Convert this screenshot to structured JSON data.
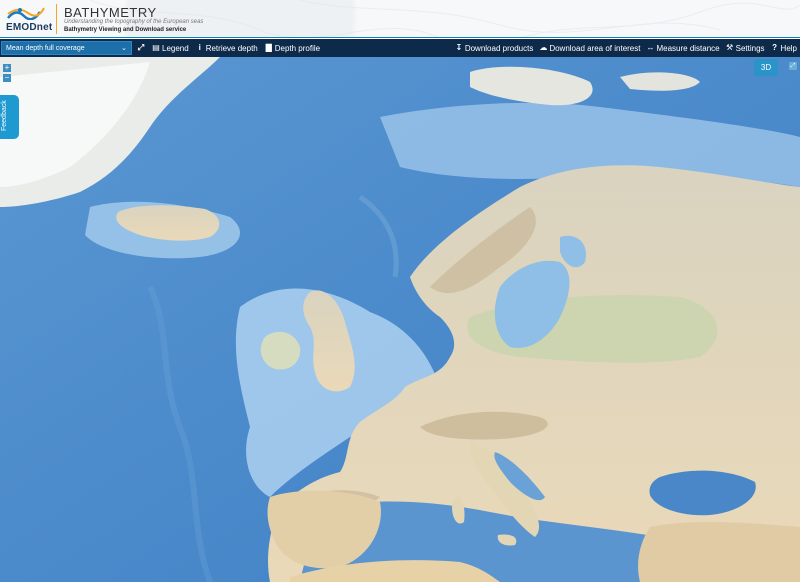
{
  "header": {
    "logo_text": "EMODnet",
    "title": "BATHYMETRY",
    "tagline": "Understanding the topography of the European seas",
    "service": "Bathymetry Viewing and Download service"
  },
  "toolbar": {
    "layer_select": "Mean depth full coverage",
    "left_items": [
      {
        "label": "",
        "icon": "fullscreen-icon"
      },
      {
        "label": "Legend",
        "icon": "legend-icon"
      },
      {
        "label": "Retrieve depth",
        "icon": "info-icon"
      },
      {
        "label": "Depth profile",
        "icon": "chart-icon"
      }
    ],
    "right_items": [
      {
        "label": "Download products",
        "icon": "download-icon"
      },
      {
        "label": "Download area of interest",
        "icon": "cloud-download-icon"
      },
      {
        "label": "Measure distance",
        "icon": "measure-icon"
      },
      {
        "label": "Settings",
        "icon": "wrench-icon"
      },
      {
        "label": "Help",
        "icon": "help-icon"
      }
    ]
  },
  "map": {
    "zoom_in": "+",
    "zoom_out": "−",
    "feedback_label": "Feedback",
    "view_3d_label": "3D",
    "colors": {
      "deep_sea": "#4f8fce",
      "shelf_sea": "#a9d0ee",
      "land": "#e6ddc1",
      "mountains": "#c9b899",
      "lowland": "#b9d6a8"
    }
  }
}
